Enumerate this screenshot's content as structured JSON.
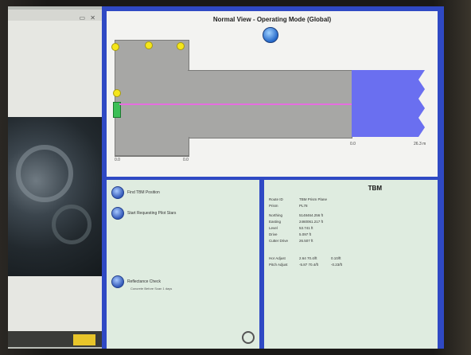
{
  "top_pane": {
    "title": "Normal View - Operating Mode (Global)"
  },
  "ticks": [
    "0.0",
    "0.0",
    "0.0",
    "26.3 m"
  ],
  "bottom_left": {
    "items": [
      {
        "label": "Find TBM Position"
      },
      {
        "label": "Start Requesting Pilot Stars"
      },
      {
        "label": "Reflectance Check",
        "sub": "Concrete Before Scan 1 days"
      }
    ]
  },
  "tbm_panel": {
    "title": "TBM",
    "rows": [
      {
        "k": "Route ID",
        "v": "TBM Prism Plane"
      },
      {
        "k": "Prism",
        "v": "PL78"
      },
      {
        "k": "Northing",
        "v": "5148464.256 ft"
      },
      {
        "k": "Easting",
        "v": "2460061.217 ft"
      },
      {
        "k": "Level",
        "v": "53.741 ft"
      },
      {
        "k": "Drive",
        "v": "5.097 ft"
      },
      {
        "k": "Cutter Drive",
        "v": "26.507 ft"
      },
      {
        "k": "Hor Adjust",
        "v": "2.64 70.4/ft",
        "v2": "0.10/ft"
      },
      {
        "k": "Pitch Adjust",
        "v": "-5.87 70.4/ft",
        "v2": "-0.23/ft"
      }
    ]
  }
}
